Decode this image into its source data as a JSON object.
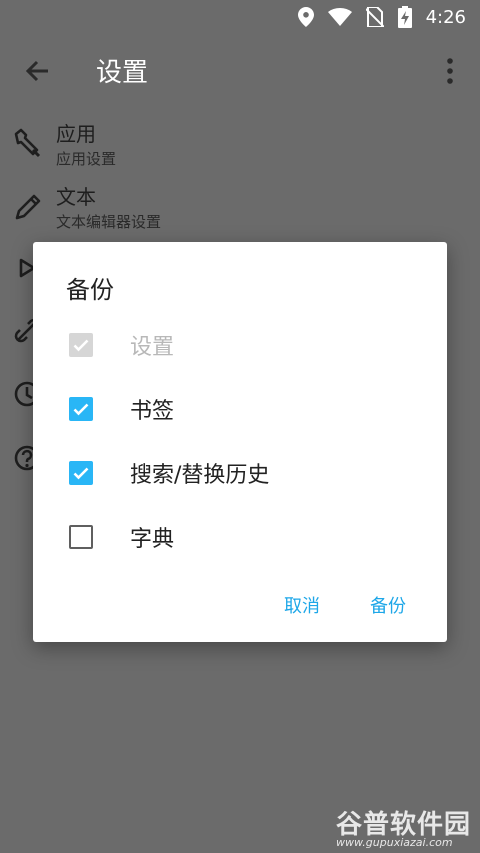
{
  "status_bar": {
    "time": "4:26"
  },
  "toolbar": {
    "title": "设置"
  },
  "settings": [
    {
      "title": "应用",
      "subtitle": "应用设置",
      "icon": "wrench-icon"
    },
    {
      "title": "文本",
      "subtitle": "文本编辑器设置",
      "icon": "pencil-icon"
    }
  ],
  "dialog": {
    "title": "备份",
    "options": [
      {
        "label": "设置",
        "state": "checked-disabled"
      },
      {
        "label": "书签",
        "state": "checked"
      },
      {
        "label": "搜索/替换历史",
        "state": "checked"
      },
      {
        "label": "字典",
        "state": "unchecked"
      }
    ],
    "cancel_label": "取消",
    "confirm_label": "备份"
  },
  "watermark": {
    "brand": "谷普软件园",
    "url": "www.gupuxiazai.com"
  },
  "colors": {
    "accent": "#29b6f6",
    "scrim": "#6b6b6b",
    "dialog_bg": "#ffffff"
  }
}
